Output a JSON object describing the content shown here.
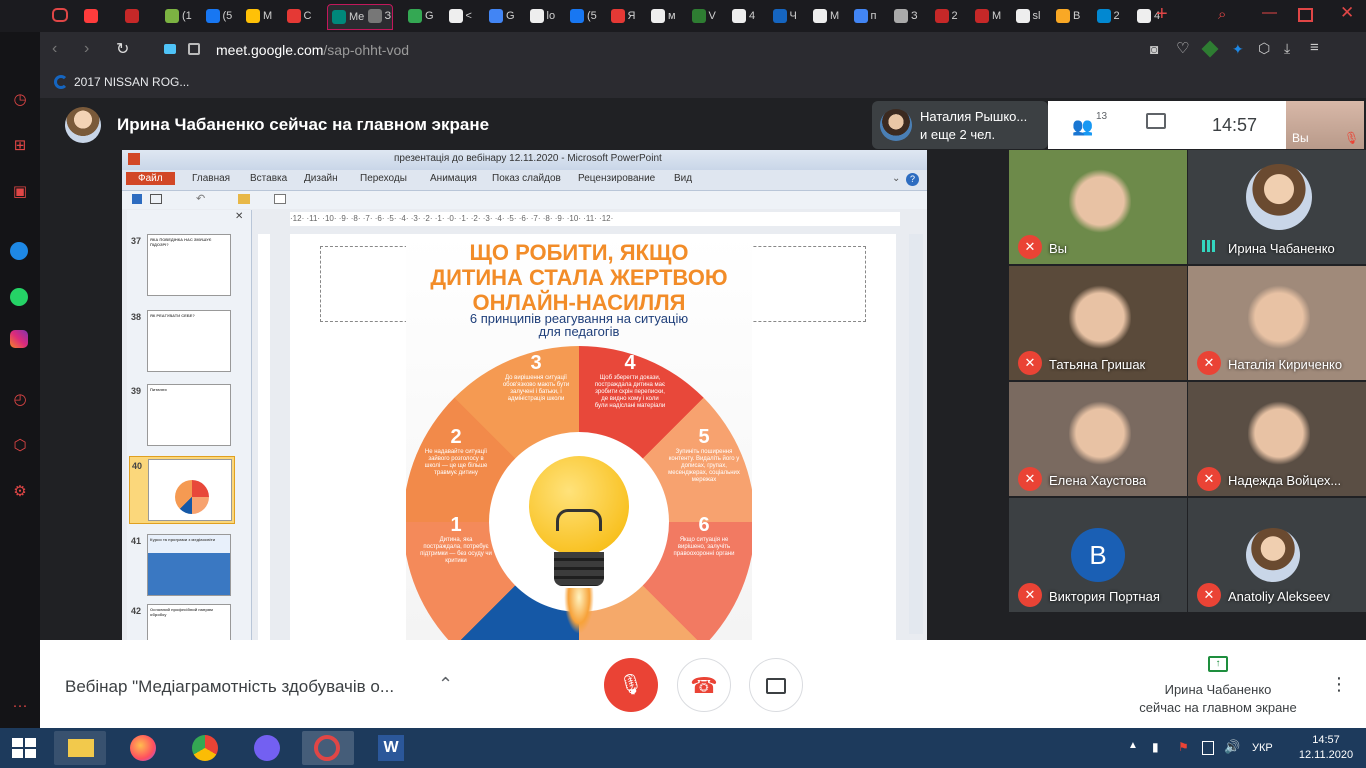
{
  "browser": {
    "tabs": [
      {
        "label": "",
        "color": "#ff3c3c"
      },
      {
        "label": "",
        "color": "#c62828"
      },
      {
        "label": "(1",
        "color": "#7cb342"
      },
      {
        "label": "(5",
        "color": "#1877f2"
      },
      {
        "label": "M",
        "color": "#ffc107"
      },
      {
        "label": "C",
        "color": "#e53935"
      },
      {
        "label": "Me",
        "color": "#00897b",
        "active": true
      },
      {
        "label": "З",
        "color": "#777"
      },
      {
        "label": "G",
        "color": "#34a853"
      },
      {
        "label": "<",
        "color": "#eee"
      },
      {
        "label": "G",
        "color": "#4285f4"
      },
      {
        "label": "lo",
        "color": "#eee"
      },
      {
        "label": "(5",
        "color": "#1877f2"
      },
      {
        "label": "Я",
        "color": "#e53935"
      },
      {
        "label": "м",
        "color": "#eee"
      },
      {
        "label": "V",
        "color": "#2e7d32"
      },
      {
        "label": "4",
        "color": "#eee"
      },
      {
        "label": "Ч",
        "color": "#1565c0"
      },
      {
        "label": "M",
        "color": "#eee"
      },
      {
        "label": "п",
        "color": "#4285f4"
      },
      {
        "label": "З",
        "color": "#aaa"
      },
      {
        "label": "2",
        "color": "#c62828"
      },
      {
        "label": "M",
        "color": "#c62828"
      },
      {
        "label": "sl",
        "color": "#eee"
      },
      {
        "label": "В",
        "color": "#f9a825"
      },
      {
        "label": "2",
        "color": "#0288d1"
      },
      {
        "label": "4",
        "color": "#eee"
      }
    ],
    "new_tab": "+",
    "url_host": "meet.google.com",
    "url_path": "/sap-ohht-vod",
    "bookmark": "2017 NISSAN ROG..."
  },
  "meet": {
    "presenter_banner": "Ирина Чабаненко сейчас на главном экране",
    "participants_preview_name": "Наталия Рышко...",
    "participants_preview_more": "и еще 2 чел.",
    "participants_count": "13",
    "clock": "14:57",
    "self_label": "Вы",
    "tiles": [
      {
        "name": "Вы",
        "bg": "#6d8a4a",
        "muted": true
      },
      {
        "name": "Ирина Чабаненко",
        "bg": "#3c4043",
        "muted": false
      },
      {
        "name": "Татьяна Гришак",
        "bg": "#5a4a3a",
        "muted": true
      },
      {
        "name": "Наталія Кириченко",
        "bg": "#a08a7a",
        "muted": true
      },
      {
        "name": "Елена Хаустова",
        "bg": "#7a6a60",
        "muted": true
      },
      {
        "name": "Надежда Войцех...",
        "bg": "#5a4e44",
        "muted": true
      },
      {
        "name": "Виктория Портная",
        "bg": "#3c4043",
        "muted": true,
        "initial": "В",
        "initial_color": "#1a5fb4"
      },
      {
        "name": "Anatoliy Alekseev",
        "bg": "#3c4043",
        "muted": true
      }
    ],
    "meeting_title": "Вебінар \"Медіаграмотність здобувачів о...",
    "presenting_line1": "Ирина Чабаненко",
    "presenting_line2": "сейчас на главном экране"
  },
  "ppt": {
    "title": "презентація до вебінару 12.11.2020  -  Microsoft PowerPoint",
    "menu": [
      "Файл",
      "Главная",
      "Вставка",
      "Дизайн",
      "Переходы",
      "Анимация",
      "Показ слайдов",
      "Рецензирование",
      "Вид"
    ],
    "ruler": "·12· ·11· ·10· ·9· ·8· ·7· ·6· ·5· ·4· ·3· ·2· ·1· ·0· ·1· ·2· ·3· ·4· ·5· ·6· ·7· ·8· ·9· ·10· ·11· ·12·",
    "thumbs": [
      {
        "num": "37",
        "title": "ЯКА ПОВЕДІНКА НАС ЗМУШУЄ ПІДОЗРІ?"
      },
      {
        "num": "38",
        "title": "ЯК РЕАГУВАТИ СЕБЕ?"
      },
      {
        "num": "39",
        "title": "Питання"
      },
      {
        "num": "40",
        "title": ""
      },
      {
        "num": "41",
        "title": "Курси та програми з медіаосвіти"
      },
      {
        "num": "42",
        "title": "Основний професійний напрям обробку"
      }
    ],
    "slide": {
      "heading_l1": "ЩО РОБИТИ, ЯКЩО",
      "heading_l2": "ДИТИНА СТАЛА ЖЕРТВОЮ",
      "heading_l3": "ОНЛАЙН-НАСИЛЛЯ",
      "sub_l1": "6 принципів реагування на ситуацію",
      "sub_l2": "для педагогів",
      "steps": [
        {
          "n": "1",
          "text": "Дитина, яка постраждала, потребує підтримки — без осуду чи критики"
        },
        {
          "n": "2",
          "text": "Не надавайте ситуації зайвого розголосу в школі — це ще більше травмує дитину"
        },
        {
          "n": "3",
          "text": "До вирішення ситуації обов'язково мають бути залучені і батьки, і адміністрація школи"
        },
        {
          "n": "4",
          "text": "Щоб зберегти докази, постраждала дитина має зробити скрін переписки, де видно кому і коли були надіслані матеріали"
        },
        {
          "n": "5",
          "text": "Зупиніть поширення контенту. Видаліть його у дописах, групах, месенджерах, соціальних мережах"
        },
        {
          "n": "6",
          "text": "Якщо ситуація не вирішено, залучіть правоохоронні органи"
        }
      ]
    }
  },
  "taskbar": {
    "lang": "УКР",
    "time": "14:57",
    "date": "12.11.2020"
  }
}
